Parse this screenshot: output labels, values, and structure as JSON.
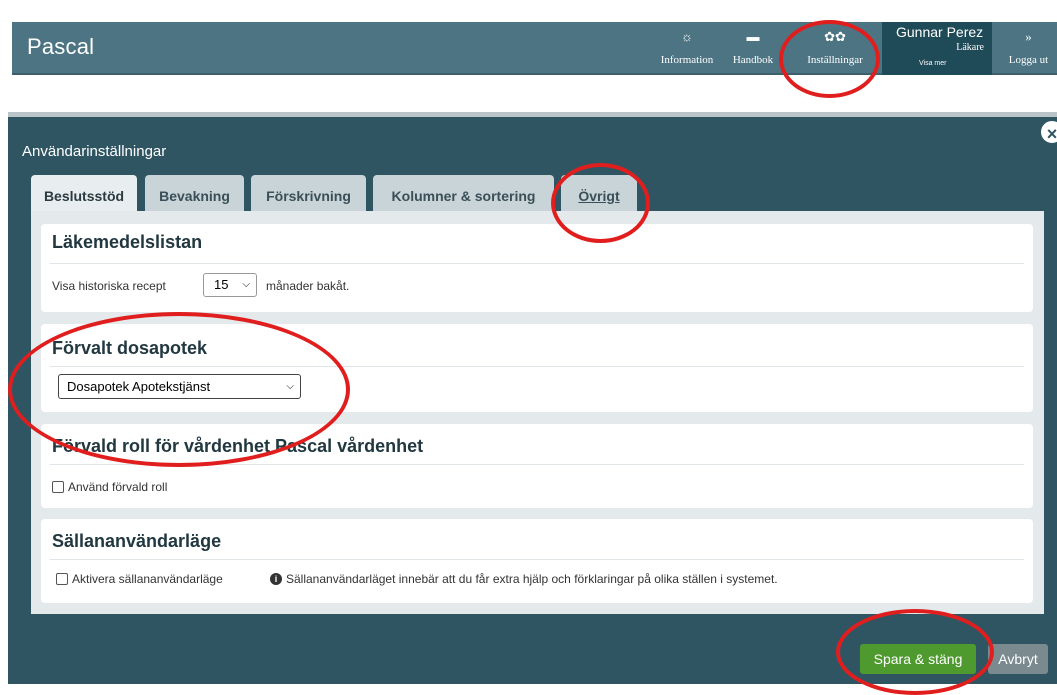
{
  "app": {
    "title": "Pascal"
  },
  "nav": {
    "information": "Information",
    "handbook": "Handbok",
    "settings": "Inställningar",
    "logout": "Logga ut"
  },
  "user": {
    "name": "Gunnar Perez",
    "role": "Läkare",
    "more": "Visa mer"
  },
  "modal": {
    "title": "Användarinställningar",
    "close": "×"
  },
  "tabs": [
    {
      "label": "Beslutsstöd"
    },
    {
      "label": "Bevakning"
    },
    {
      "label": "Förskrivning"
    },
    {
      "label": "Kolumner & sortering"
    },
    {
      "label": "Övrigt"
    }
  ],
  "sections": {
    "medlist": {
      "title": "Läkemedelslistan",
      "prefix": "Visa historiska recept",
      "value": "15",
      "suffix": "månader bakåt."
    },
    "pharmacy": {
      "title": "Förvalt dosapotek",
      "value": "Dosapotek Apotekstjänst"
    },
    "role": {
      "title": "Förvald roll för vårdenhet Pascal vårdenhet",
      "checkbox": "Använd förvald roll"
    },
    "rare": {
      "title": "Sällananvändarläge",
      "checkbox": "Aktivera sällananvändarläge",
      "info": "Sällananvändarläget innebär att du får extra hjälp och förklaringar på olika ställen i systemet."
    }
  },
  "buttons": {
    "save": "Spara & stäng",
    "cancel": "Avbryt"
  },
  "colors": {
    "topbar": "#4d7482",
    "modal": "#2f5563",
    "save": "#4e9a2e",
    "annotation": "#e01e1e"
  }
}
